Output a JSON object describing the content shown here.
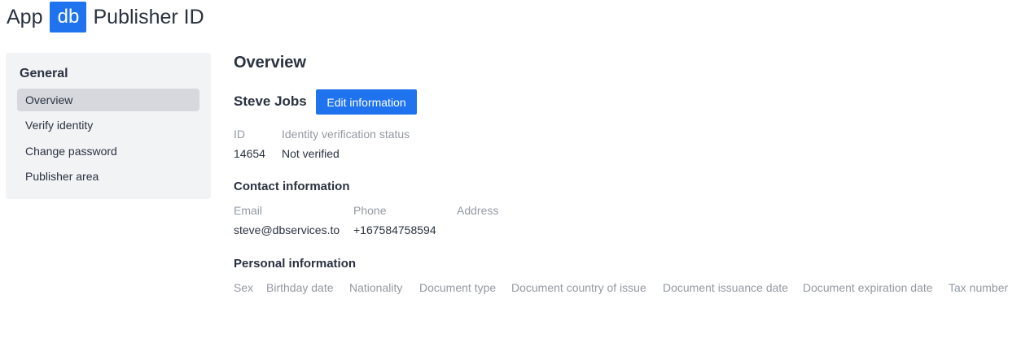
{
  "header": {
    "app_text": "App",
    "logo_text": "db",
    "title": "Publisher ID"
  },
  "sidebar": {
    "heading": "General",
    "items": [
      {
        "label": "Overview",
        "active": true
      },
      {
        "label": "Verify identity",
        "active": false
      },
      {
        "label": "Change password",
        "active": false
      },
      {
        "label": "Publisher area",
        "active": false
      }
    ]
  },
  "main": {
    "title": "Overview",
    "user_name": "Steve Jobs",
    "edit_button": "Edit information",
    "identity": {
      "id_label": "ID",
      "id_value": "14654",
      "status_label": "Identity verification status",
      "status_value": "Not verified"
    },
    "contact": {
      "title": "Contact information",
      "email_label": "Email",
      "email_value": "steve@dbservices.to",
      "phone_label": "Phone",
      "phone_value": "+167584758594",
      "address_label": "Address"
    },
    "personal": {
      "title": "Personal information",
      "fields": [
        "Sex",
        "Birthday date",
        "Nationality",
        "Document type",
        "Document country of issue",
        "Document issuance date",
        "Document expiration date",
        "Tax number"
      ]
    }
  },
  "colors": {
    "accent": "#1f73ee",
    "sidebar_bg": "#f2f3f5",
    "sidebar_active_bg": "#d6d8dd",
    "text": "#2a3240",
    "muted": "#9399a3"
  }
}
